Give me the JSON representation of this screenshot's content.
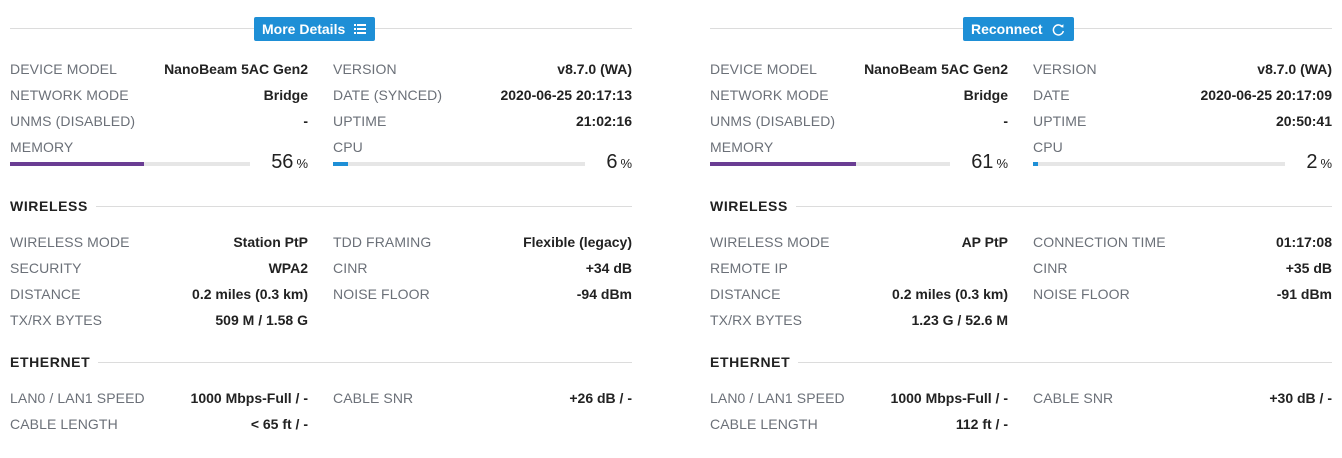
{
  "left": {
    "button": {
      "label": "More Details",
      "icon": "list-icon"
    },
    "general": {
      "device_model": {
        "label": "DEVICE MODEL",
        "value": "NanoBeam 5AC Gen2"
      },
      "network_mode": {
        "label": "NETWORK MODE",
        "value": "Bridge"
      },
      "unms": {
        "label": "UNMS (DISABLED)",
        "value": "-"
      },
      "version": {
        "label": "VERSION",
        "value": "v8.7.0 (WA)"
      },
      "date": {
        "label": "DATE (SYNCED)",
        "value": "2020-06-25 20:17:13"
      },
      "uptime": {
        "label": "UPTIME",
        "value": "21:02:16"
      },
      "memory": {
        "label": "MEMORY",
        "value": "56",
        "unit": "%",
        "fraction": 0.56
      },
      "cpu": {
        "label": "CPU",
        "value": "6",
        "unit": "%",
        "fraction": 0.06
      }
    },
    "wireless": {
      "title": "WIRELESS",
      "rows": [
        {
          "l_label": "WIRELESS MODE",
          "l_value": "Station PtP",
          "r_label": "TDD FRAMING",
          "r_value": "Flexible (legacy)"
        },
        {
          "l_label": "SECURITY",
          "l_value": "WPA2",
          "r_label": "CINR",
          "r_value": "+34 dB"
        },
        {
          "l_label": "DISTANCE",
          "l_value": "0.2 miles (0.3 km)",
          "r_label": "NOISE FLOOR",
          "r_value": "-94 dBm"
        },
        {
          "l_label": "TX/RX BYTES",
          "l_value": "509 M / 1.58 G",
          "r_label": "",
          "r_value": ""
        }
      ]
    },
    "ethernet": {
      "title": "ETHERNET",
      "rows": [
        {
          "l_label": "LAN0 / LAN1 SPEED",
          "l_value": "1000 Mbps-Full / -",
          "r_label": "CABLE SNR",
          "r_value": "+26 dB / -"
        },
        {
          "l_label": "CABLE LENGTH",
          "l_value": "< 65 ft / -",
          "r_label": "",
          "r_value": ""
        }
      ]
    }
  },
  "right": {
    "button": {
      "label": "Reconnect",
      "icon": "refresh-icon"
    },
    "general": {
      "device_model": {
        "label": "DEVICE MODEL",
        "value": "NanoBeam 5AC Gen2"
      },
      "network_mode": {
        "label": "NETWORK MODE",
        "value": "Bridge"
      },
      "unms": {
        "label": "UNMS (DISABLED)",
        "value": "-"
      },
      "version": {
        "label": "VERSION",
        "value": "v8.7.0 (WA)"
      },
      "date": {
        "label": "DATE",
        "value": "2020-06-25 20:17:09"
      },
      "uptime": {
        "label": "UPTIME",
        "value": "20:50:41"
      },
      "memory": {
        "label": "MEMORY",
        "value": "61",
        "unit": "%",
        "fraction": 0.61
      },
      "cpu": {
        "label": "CPU",
        "value": "2",
        "unit": "%",
        "fraction": 0.02
      }
    },
    "wireless": {
      "title": "WIRELESS",
      "rows": [
        {
          "l_label": "WIRELESS MODE",
          "l_value": "AP PtP",
          "r_label": "CONNECTION TIME",
          "r_value": "01:17:08"
        },
        {
          "l_label": "REMOTE IP",
          "l_value": "",
          "r_label": "CINR",
          "r_value": "+35 dB"
        },
        {
          "l_label": "DISTANCE",
          "l_value": "0.2 miles (0.3 km)",
          "r_label": "NOISE FLOOR",
          "r_value": "-91 dBm"
        },
        {
          "l_label": "TX/RX BYTES",
          "l_value": "1.23 G / 52.6 M",
          "r_label": "",
          "r_value": ""
        }
      ]
    },
    "ethernet": {
      "title": "ETHERNET",
      "rows": [
        {
          "l_label": "LAN0 / LAN1 SPEED",
          "l_value": "1000 Mbps-Full / -",
          "r_label": "CABLE SNR",
          "r_value": "+30 dB / -"
        },
        {
          "l_label": "CABLE LENGTH",
          "l_value": "112 ft / -",
          "r_label": "",
          "r_value": ""
        }
      ]
    }
  },
  "colors": {
    "accent": "#1e8fd6",
    "memory_bar": "#6a3d93",
    "cpu_bar": "#1e8fd6",
    "track": "#e6e6e6"
  }
}
